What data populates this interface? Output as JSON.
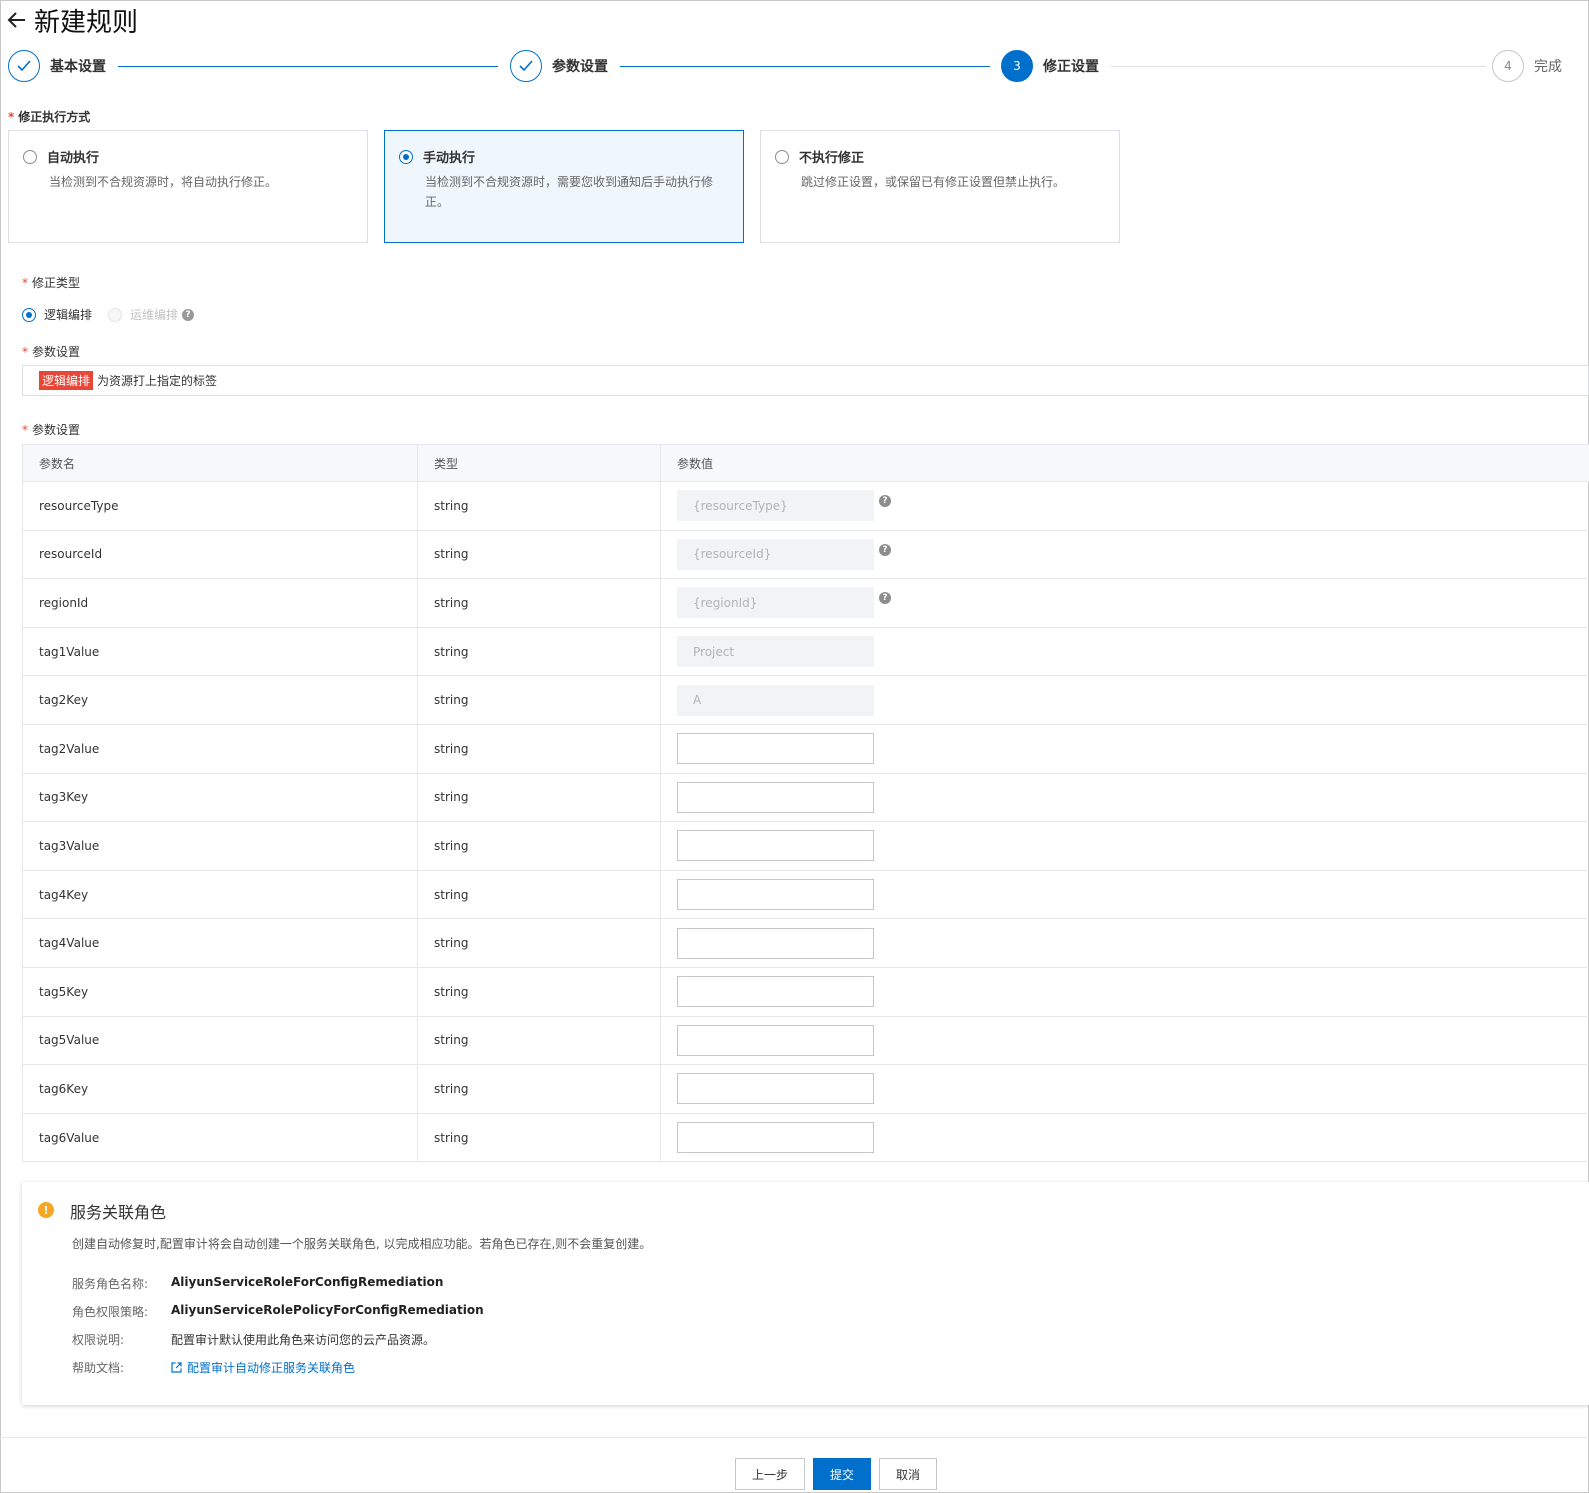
{
  "header": {
    "title": "新建规则"
  },
  "steps": [
    {
      "label": "基本设置",
      "state": "done"
    },
    {
      "label": "参数设置",
      "state": "done"
    },
    {
      "label": "修正设置",
      "state": "active",
      "number": "3"
    },
    {
      "label": "完成",
      "state": "todo",
      "number": "4"
    }
  ],
  "exec_mode": {
    "label": "修正执行方式",
    "options": [
      {
        "title": "自动执行",
        "desc": "当检测到不合规资源时，将自动执行修正。",
        "checked": false
      },
      {
        "title": "手动执行",
        "desc": "当检测到不合规资源时，需要您收到通知后手动执行修正。",
        "checked": true
      },
      {
        "title": "不执行修正",
        "desc": "跳过修正设置，或保留已有修正设置但禁止执行。",
        "checked": false
      }
    ]
  },
  "fix_type": {
    "label": "修正类型",
    "options": [
      {
        "label": "逻辑编排",
        "checked": true,
        "disabled": false
      },
      {
        "label": "运维编排",
        "checked": false,
        "disabled": true
      }
    ]
  },
  "param_template": {
    "label": "参数设置",
    "tag": "逻辑编排",
    "text": "为资源打上指定的标签"
  },
  "param_table": {
    "label": "参数设置",
    "headers": [
      "参数名",
      "类型",
      "参数值"
    ],
    "rows": [
      {
        "name": "resourceType",
        "type": "string",
        "value": "{resourceType}",
        "disabled": true,
        "help": true
      },
      {
        "name": "resourceId",
        "type": "string",
        "value": "{resourceId}",
        "disabled": true,
        "help": true
      },
      {
        "name": "regionId",
        "type": "string",
        "value": "{regionId}",
        "disabled": true,
        "help": true
      },
      {
        "name": "tag1Value",
        "type": "string",
        "value": "Project",
        "disabled": true,
        "help": false
      },
      {
        "name": "tag2Key",
        "type": "string",
        "value": "A",
        "disabled": true,
        "help": false
      },
      {
        "name": "tag2Value",
        "type": "string",
        "value": "",
        "disabled": false,
        "help": false
      },
      {
        "name": "tag3Key",
        "type": "string",
        "value": "",
        "disabled": false,
        "help": false
      },
      {
        "name": "tag3Value",
        "type": "string",
        "value": "",
        "disabled": false,
        "help": false
      },
      {
        "name": "tag4Key",
        "type": "string",
        "value": "",
        "disabled": false,
        "help": false
      },
      {
        "name": "tag4Value",
        "type": "string",
        "value": "",
        "disabled": false,
        "help": false
      },
      {
        "name": "tag5Key",
        "type": "string",
        "value": "",
        "disabled": false,
        "help": false
      },
      {
        "name": "tag5Value",
        "type": "string",
        "value": "",
        "disabled": false,
        "help": false
      },
      {
        "name": "tag6Key",
        "type": "string",
        "value": "",
        "disabled": false,
        "help": false
      },
      {
        "name": "tag6Value",
        "type": "string",
        "value": "",
        "disabled": false,
        "help": false
      }
    ]
  },
  "service_role": {
    "title": "服务关联角色",
    "desc": "创建自动修复时,配置审计将会自动创建一个服务关联角色, 以完成相应功能。若角色已存在,则不会重复创建。",
    "role_name_label": "服务角色名称:",
    "role_name": "AliyunServiceRoleForConfigRemediation",
    "policy_label": "角色权限策略:",
    "policy": "AliyunServiceRolePolicyForConfigRemediation",
    "perm_label": "权限说明:",
    "perm": "配置审计默认使用此角色来访问您的云产品资源。",
    "doc_label": "帮助文档:",
    "doc_link": "配置审计自动修正服务关联角色"
  },
  "footer": {
    "prev": "上一步",
    "submit": "提交",
    "cancel": "取消"
  },
  "colors": {
    "primary": "#0070cc",
    "required": "#e84738",
    "warning": "#f5a623"
  }
}
